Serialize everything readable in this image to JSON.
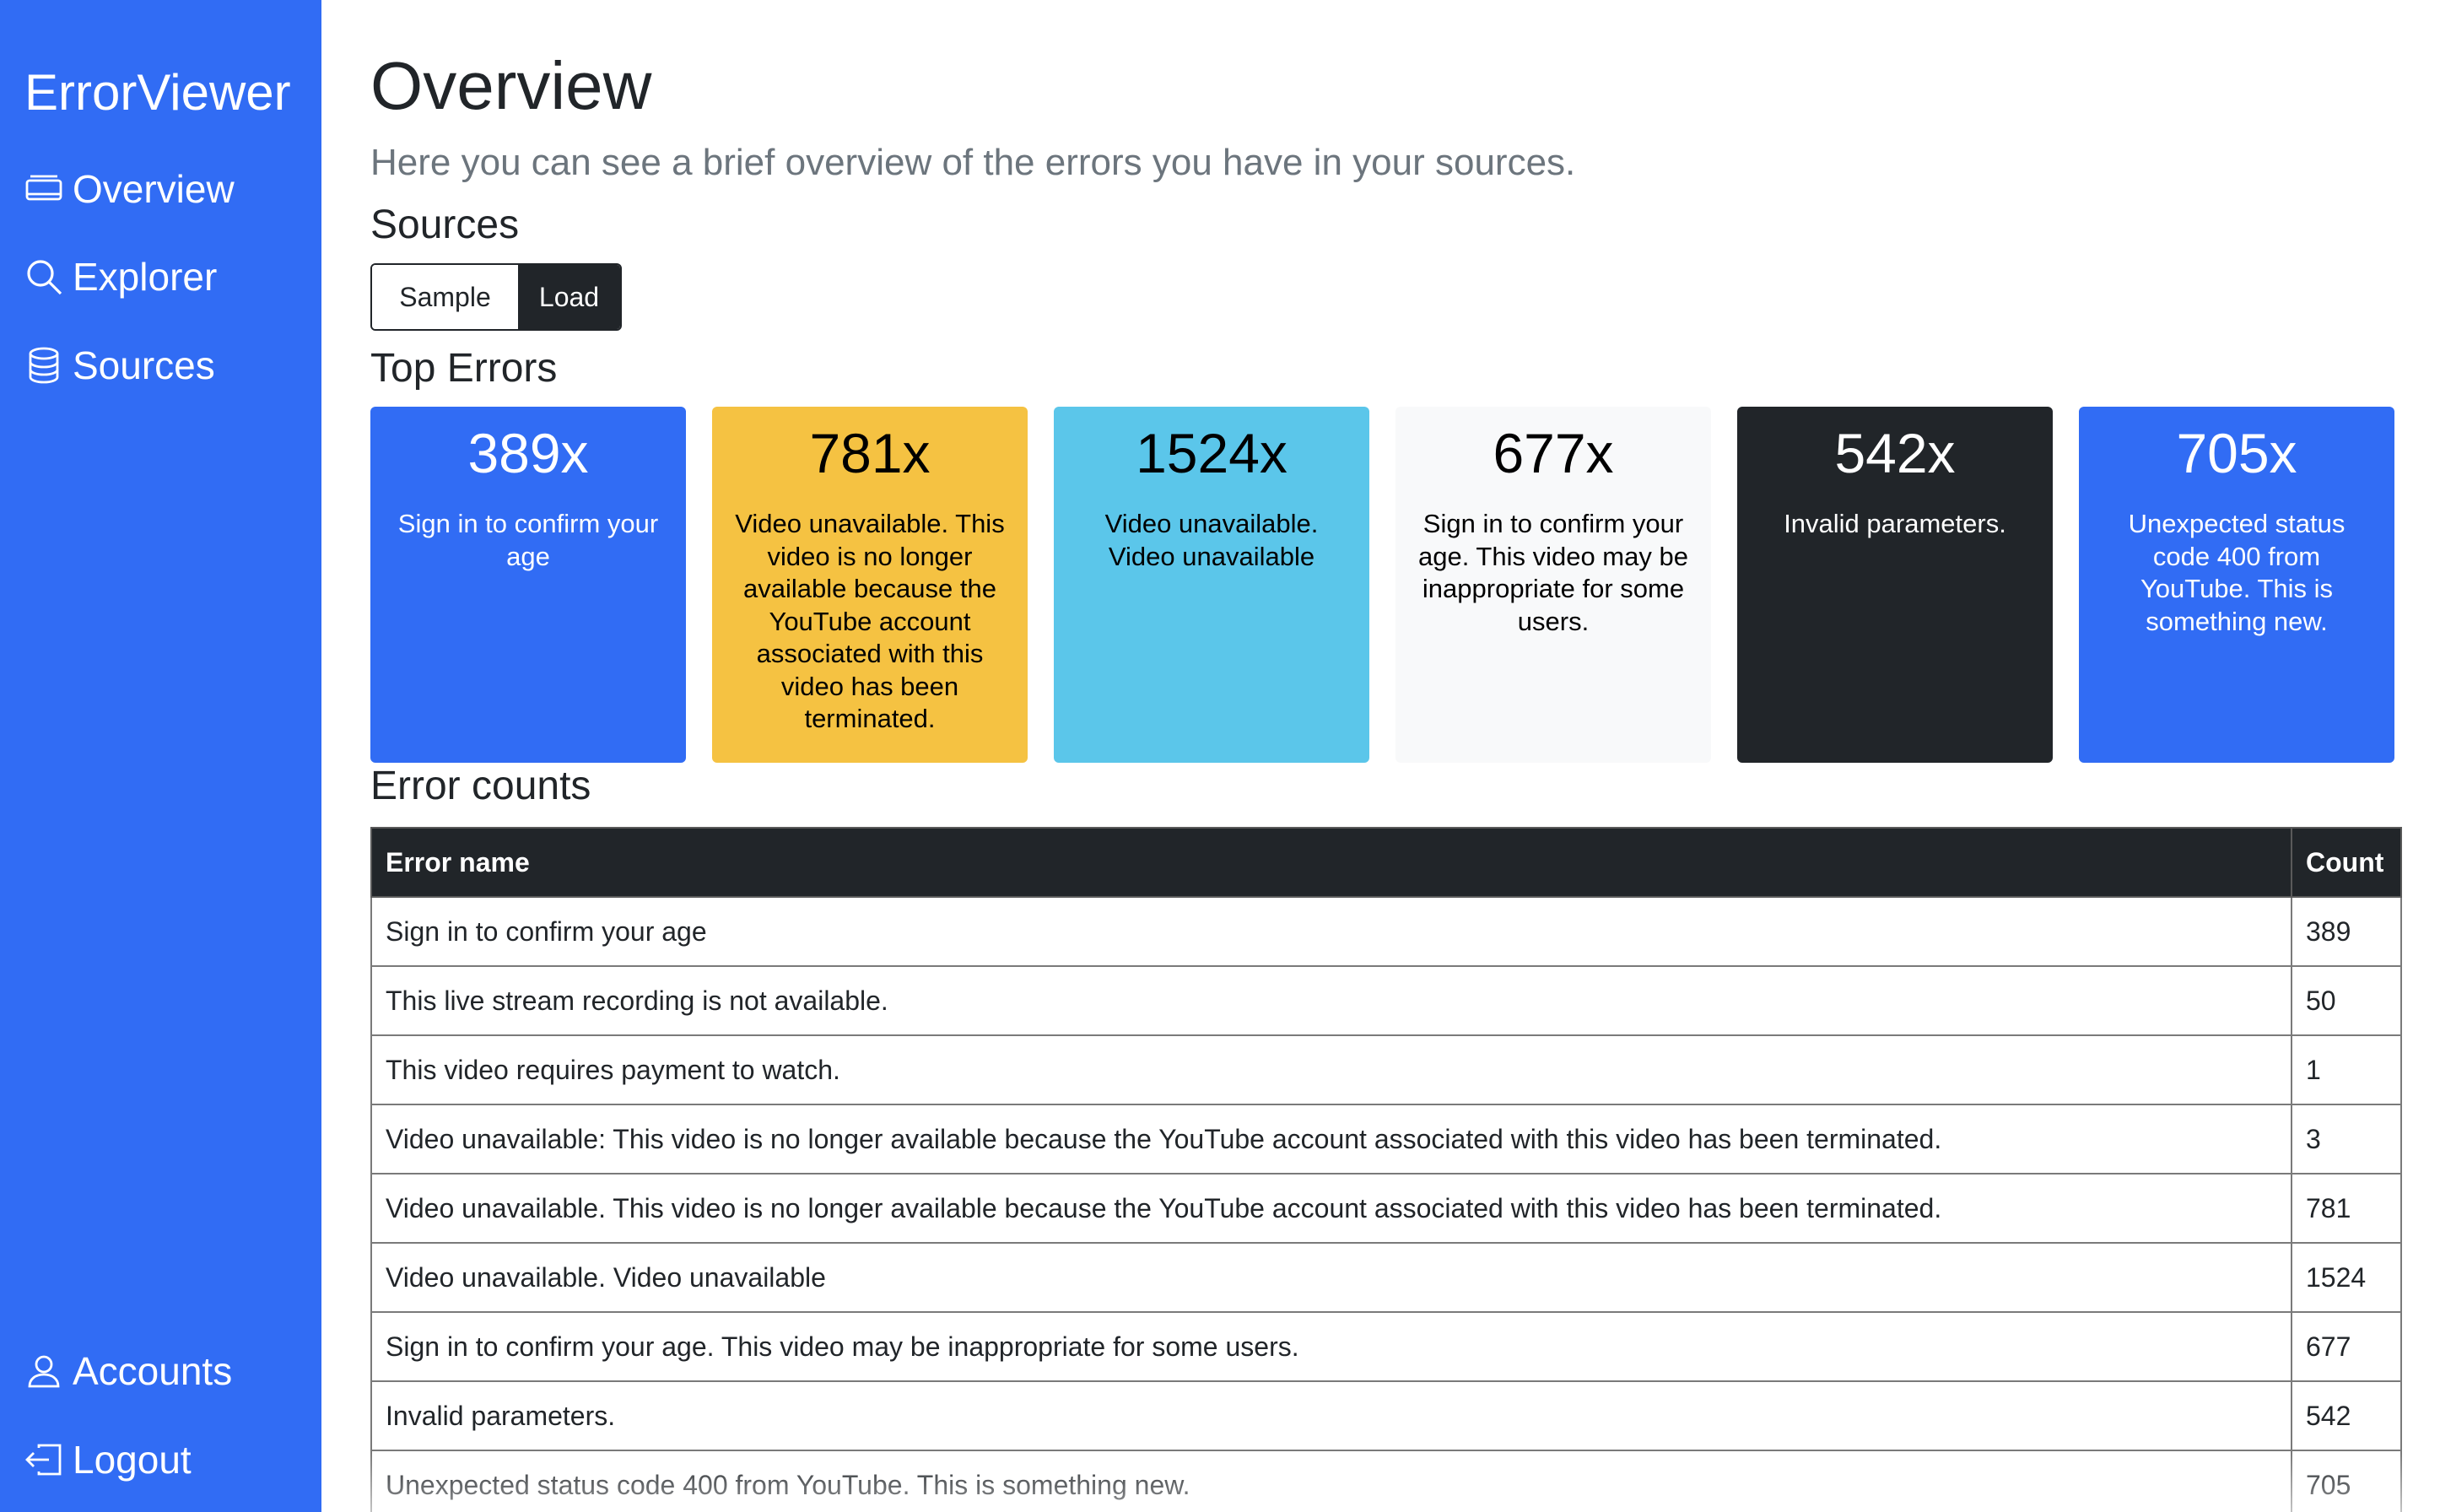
{
  "app": {
    "brand": "ErrorViewer"
  },
  "sidebar": {
    "items": [
      {
        "label": "Overview",
        "icon": "overview-icon"
      },
      {
        "label": "Explorer",
        "icon": "search-icon"
      },
      {
        "label": "Sources",
        "icon": "database-icon"
      }
    ],
    "bottom_items": [
      {
        "label": "Accounts",
        "icon": "user-icon"
      },
      {
        "label": "Logout",
        "icon": "logout-icon"
      }
    ]
  },
  "page": {
    "title": "Overview",
    "subtitle": "Here you can see a brief overview of the errors you have in your sources."
  },
  "sources": {
    "title": "Sources",
    "buttons": [
      "Sample",
      "Load"
    ],
    "selected": "Load"
  },
  "top_errors": {
    "title": "Top Errors",
    "cards": [
      {
        "count": "389x",
        "text": "Sign in to confirm your age",
        "bg": "#316cf4",
        "fg": "#ffffff"
      },
      {
        "count": "781x",
        "text": "Video unavailable. This video is no longer available because the YouTube account associated with this video has been terminated.",
        "bg": "#f5c242",
        "fg": "#000000"
      },
      {
        "count": "1524x",
        "text": "Video unavailable. Video unavailable",
        "bg": "#5bc6ea",
        "fg": "#000000"
      },
      {
        "count": "677x",
        "text": "Sign in to confirm your age. This video may be inappropriate for some users.",
        "bg": "#f8f9fa",
        "fg": "#000000"
      },
      {
        "count": "542x",
        "text": "Invalid parameters.",
        "bg": "#212529",
        "fg": "#ffffff"
      },
      {
        "count": "705x",
        "text": "Unexpected status code 400 from YouTube. This is something new.",
        "bg": "#316cf4",
        "fg": "#ffffff"
      }
    ]
  },
  "error_counts": {
    "title": "Error counts",
    "columns": [
      "Error name",
      "Count"
    ],
    "rows": [
      {
        "name": "Sign in to confirm your age",
        "count": "389"
      },
      {
        "name": "This live stream recording is not available.",
        "count": "50"
      },
      {
        "name": "This video requires payment to watch.",
        "count": "1"
      },
      {
        "name": "Video unavailable: This video is no longer available because the YouTube account associated with this video has been terminated.",
        "count": "3"
      },
      {
        "name": "Video unavailable. This video is no longer available because the YouTube account associated with this video has been terminated.",
        "count": "781"
      },
      {
        "name": "Video unavailable. Video unavailable",
        "count": "1524"
      },
      {
        "name": "Sign in to confirm your age. This video may be inappropriate for some users.",
        "count": "677"
      },
      {
        "name": "Invalid parameters.",
        "count": "542"
      },
      {
        "name": "Unexpected status code 400 from YouTube. This is something new.",
        "count": "705"
      }
    ]
  },
  "colors": {
    "primary": "#316cf4",
    "dark": "#212529",
    "muted": "#6c757d"
  }
}
